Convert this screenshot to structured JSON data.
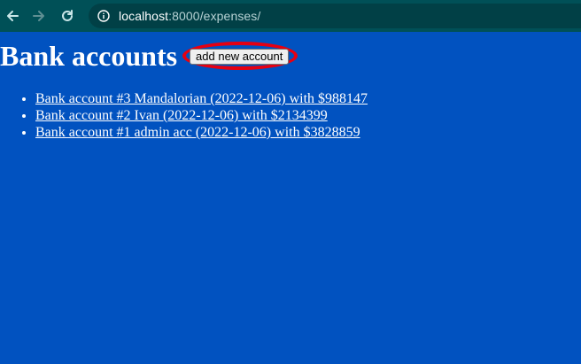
{
  "browser": {
    "url_host": "localhost",
    "url_rest": ":8000/expenses/"
  },
  "page": {
    "title": "Bank accounts",
    "add_button_label": "add new account",
    "accounts": [
      {
        "label": "Bank account #3 Mandalorian (2022-12-06) with $988147"
      },
      {
        "label": "Bank account #2 Ivan (2022-12-06) with $2134399"
      },
      {
        "label": "Bank account #1 admin acc (2022-12-06) with $3828859"
      }
    ]
  },
  "colors": {
    "page_background": "#0152c0",
    "browser_bar": "#005057",
    "highlight": "#e60012"
  },
  "icons": {
    "back": "arrow-left-icon",
    "forward": "arrow-right-icon",
    "reload": "reload-icon",
    "info": "info-icon"
  }
}
